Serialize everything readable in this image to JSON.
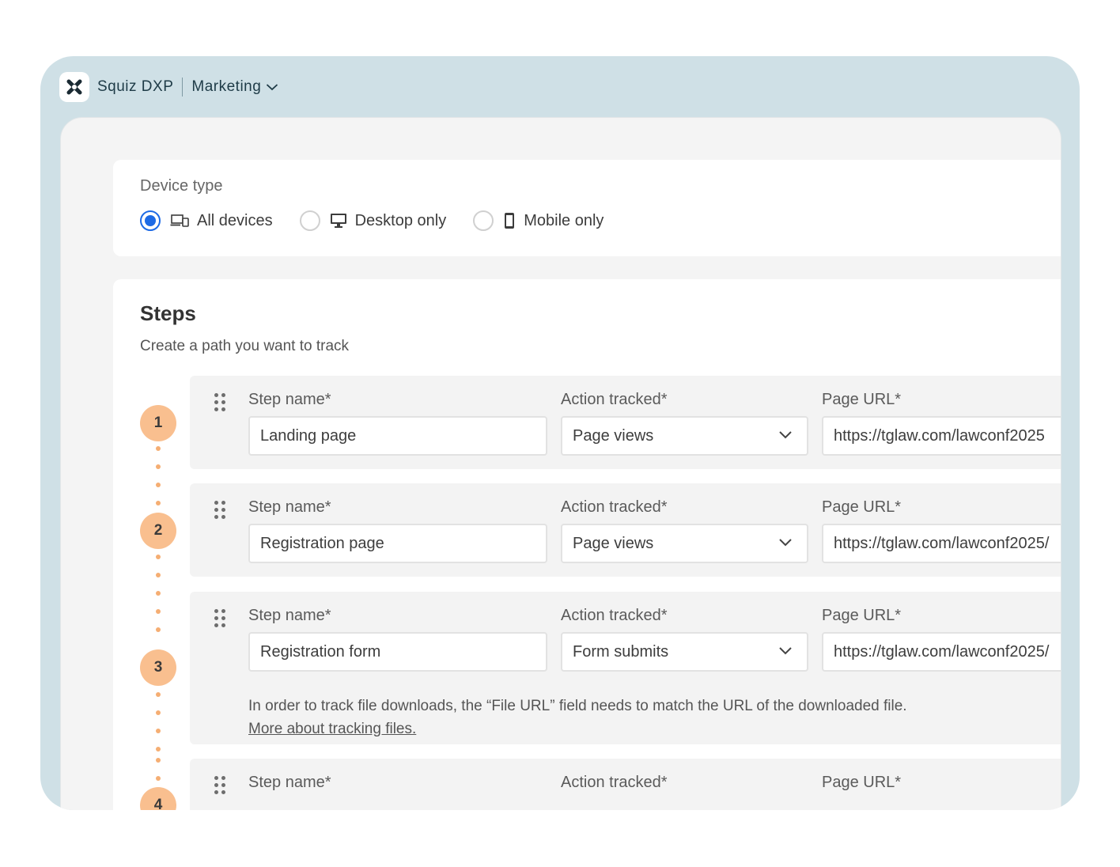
{
  "app": {
    "brand": "Squiz DXP",
    "workspace": "Marketing"
  },
  "device_type": {
    "label": "Device type",
    "options": [
      {
        "label": "All devices",
        "icon": "devices-icon",
        "selected": true
      },
      {
        "label": "Desktop only",
        "icon": "desktop-icon",
        "selected": false
      },
      {
        "label": "Mobile only",
        "icon": "mobile-icon",
        "selected": false
      }
    ]
  },
  "steps": {
    "title": "Steps",
    "subtitle": "Create a path you want to track",
    "field_labels": {
      "name": "Step name*",
      "action": "Action tracked*",
      "url": "Page URL*"
    },
    "items": [
      {
        "number": "1",
        "name": "Landing page",
        "action": "Page views",
        "url": "https://tglaw.com/lawconf2025"
      },
      {
        "number": "2",
        "name": "Registration page",
        "action": "Page views",
        "url": "https://tglaw.com/lawconf2025/"
      },
      {
        "number": "3",
        "name": "Registration form",
        "action": "Form submits",
        "url": "https://tglaw.com/lawconf2025/",
        "note": "In order to track file downloads, the “File URL” field needs to match the URL of the downloaded file.",
        "note_link": "More about tracking files."
      },
      {
        "number": "4"
      }
    ]
  },
  "colors": {
    "frame": "#cfe0e6",
    "accent": "#1d6ae5",
    "step_number": "#f9bf8f"
  }
}
